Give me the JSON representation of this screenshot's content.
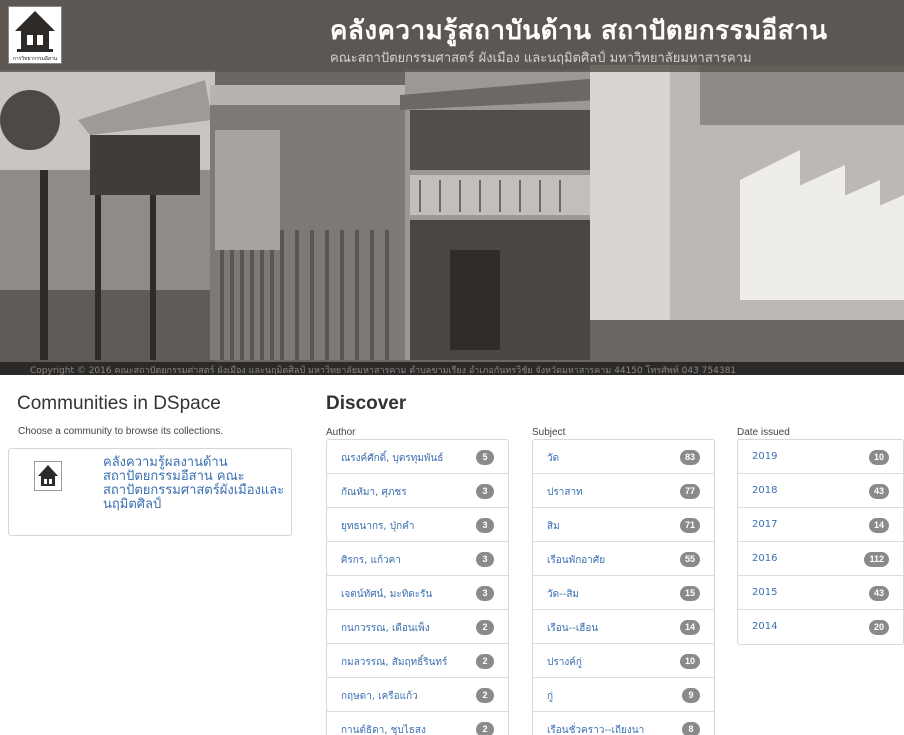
{
  "header": {
    "site_title": "คลังความรู้สถาบันด้าน สถาปัตยกรรมอีสาน",
    "site_subtitle": "คณะสถาปัตยกรรมศาสตร์ ผังเมือง และนฤมิตศิลป์ มหาวิทยาลัยมหาสารคาม",
    "logo_caption": "การวิทยากรรมอีสาน",
    "copyright": "Copyright © 2016 คณะสถาปัตยกรรมศาสตร์ ผังเมือง และนฤมิตศิลป์ มหาวิทยาลัยมหาสารคาม ตำบลขามเรียง อำเภอกันทรวิชัย จังหวัดมหาสารคาม 44150 โทรศัพท์ 043 754381"
  },
  "communities": {
    "heading": "Communities in DSpace",
    "description": "Choose a community to browse its collections.",
    "items": [
      {
        "name": "คลังความรู้ผลงานด้านสถาปัตยกรรมอีสาน คณะสถาปัตยกรรมศาสตร์ผังเมืองและนฤมิตศิลป์"
      }
    ]
  },
  "discover": {
    "heading": "Discover",
    "facets": [
      {
        "title": "Author",
        "items": [
          {
            "label": "ณรงค์ศักดิ์, บุตรทุมพันธ์",
            "count": "5"
          },
          {
            "label": "กัณหัมา, ศุภชร",
            "count": "3"
          },
          {
            "label": "ยุทธนากร, ปุ่กคำ",
            "count": "3"
          },
          {
            "label": "ศิรกร, แก้วคา",
            "count": "3"
          },
          {
            "label": "เจตน์ทัศน์, มะทิดะรัน",
            "count": "3"
          },
          {
            "label": "กนกวรรณ, เดือนเพ็ง",
            "count": "2"
          },
          {
            "label": "กมลวรรณ, สัมฤทธิ์รินทร์",
            "count": "2"
          },
          {
            "label": "กฤษดา, เครือแก้ว",
            "count": "2"
          },
          {
            "label": "กานต์ธิดา, ชุบไธสง",
            "count": "2"
          }
        ]
      },
      {
        "title": "Subject",
        "items": [
          {
            "label": "วัด",
            "count": "83"
          },
          {
            "label": "ปราสาท",
            "count": "77"
          },
          {
            "label": "สิม",
            "count": "71"
          },
          {
            "label": "เรือนพักอาศัย",
            "count": "55"
          },
          {
            "label": "วัด--สิม",
            "count": "15"
          },
          {
            "label": "เรือน--เฮือน",
            "count": "14"
          },
          {
            "label": "ปรางค์กู่",
            "count": "10"
          },
          {
            "label": "กู่",
            "count": "9"
          },
          {
            "label": "เรือนชั่วคราว--เถียงนา",
            "count": "8"
          }
        ]
      },
      {
        "title": "Date issued",
        "items": [
          {
            "label": "2019",
            "count": "10"
          },
          {
            "label": "2018",
            "count": "43"
          },
          {
            "label": "2017",
            "count": "14"
          },
          {
            "label": "2016",
            "count": "112"
          },
          {
            "label": "2015",
            "count": "43"
          },
          {
            "label": "2014",
            "count": "20"
          }
        ]
      }
    ]
  }
}
